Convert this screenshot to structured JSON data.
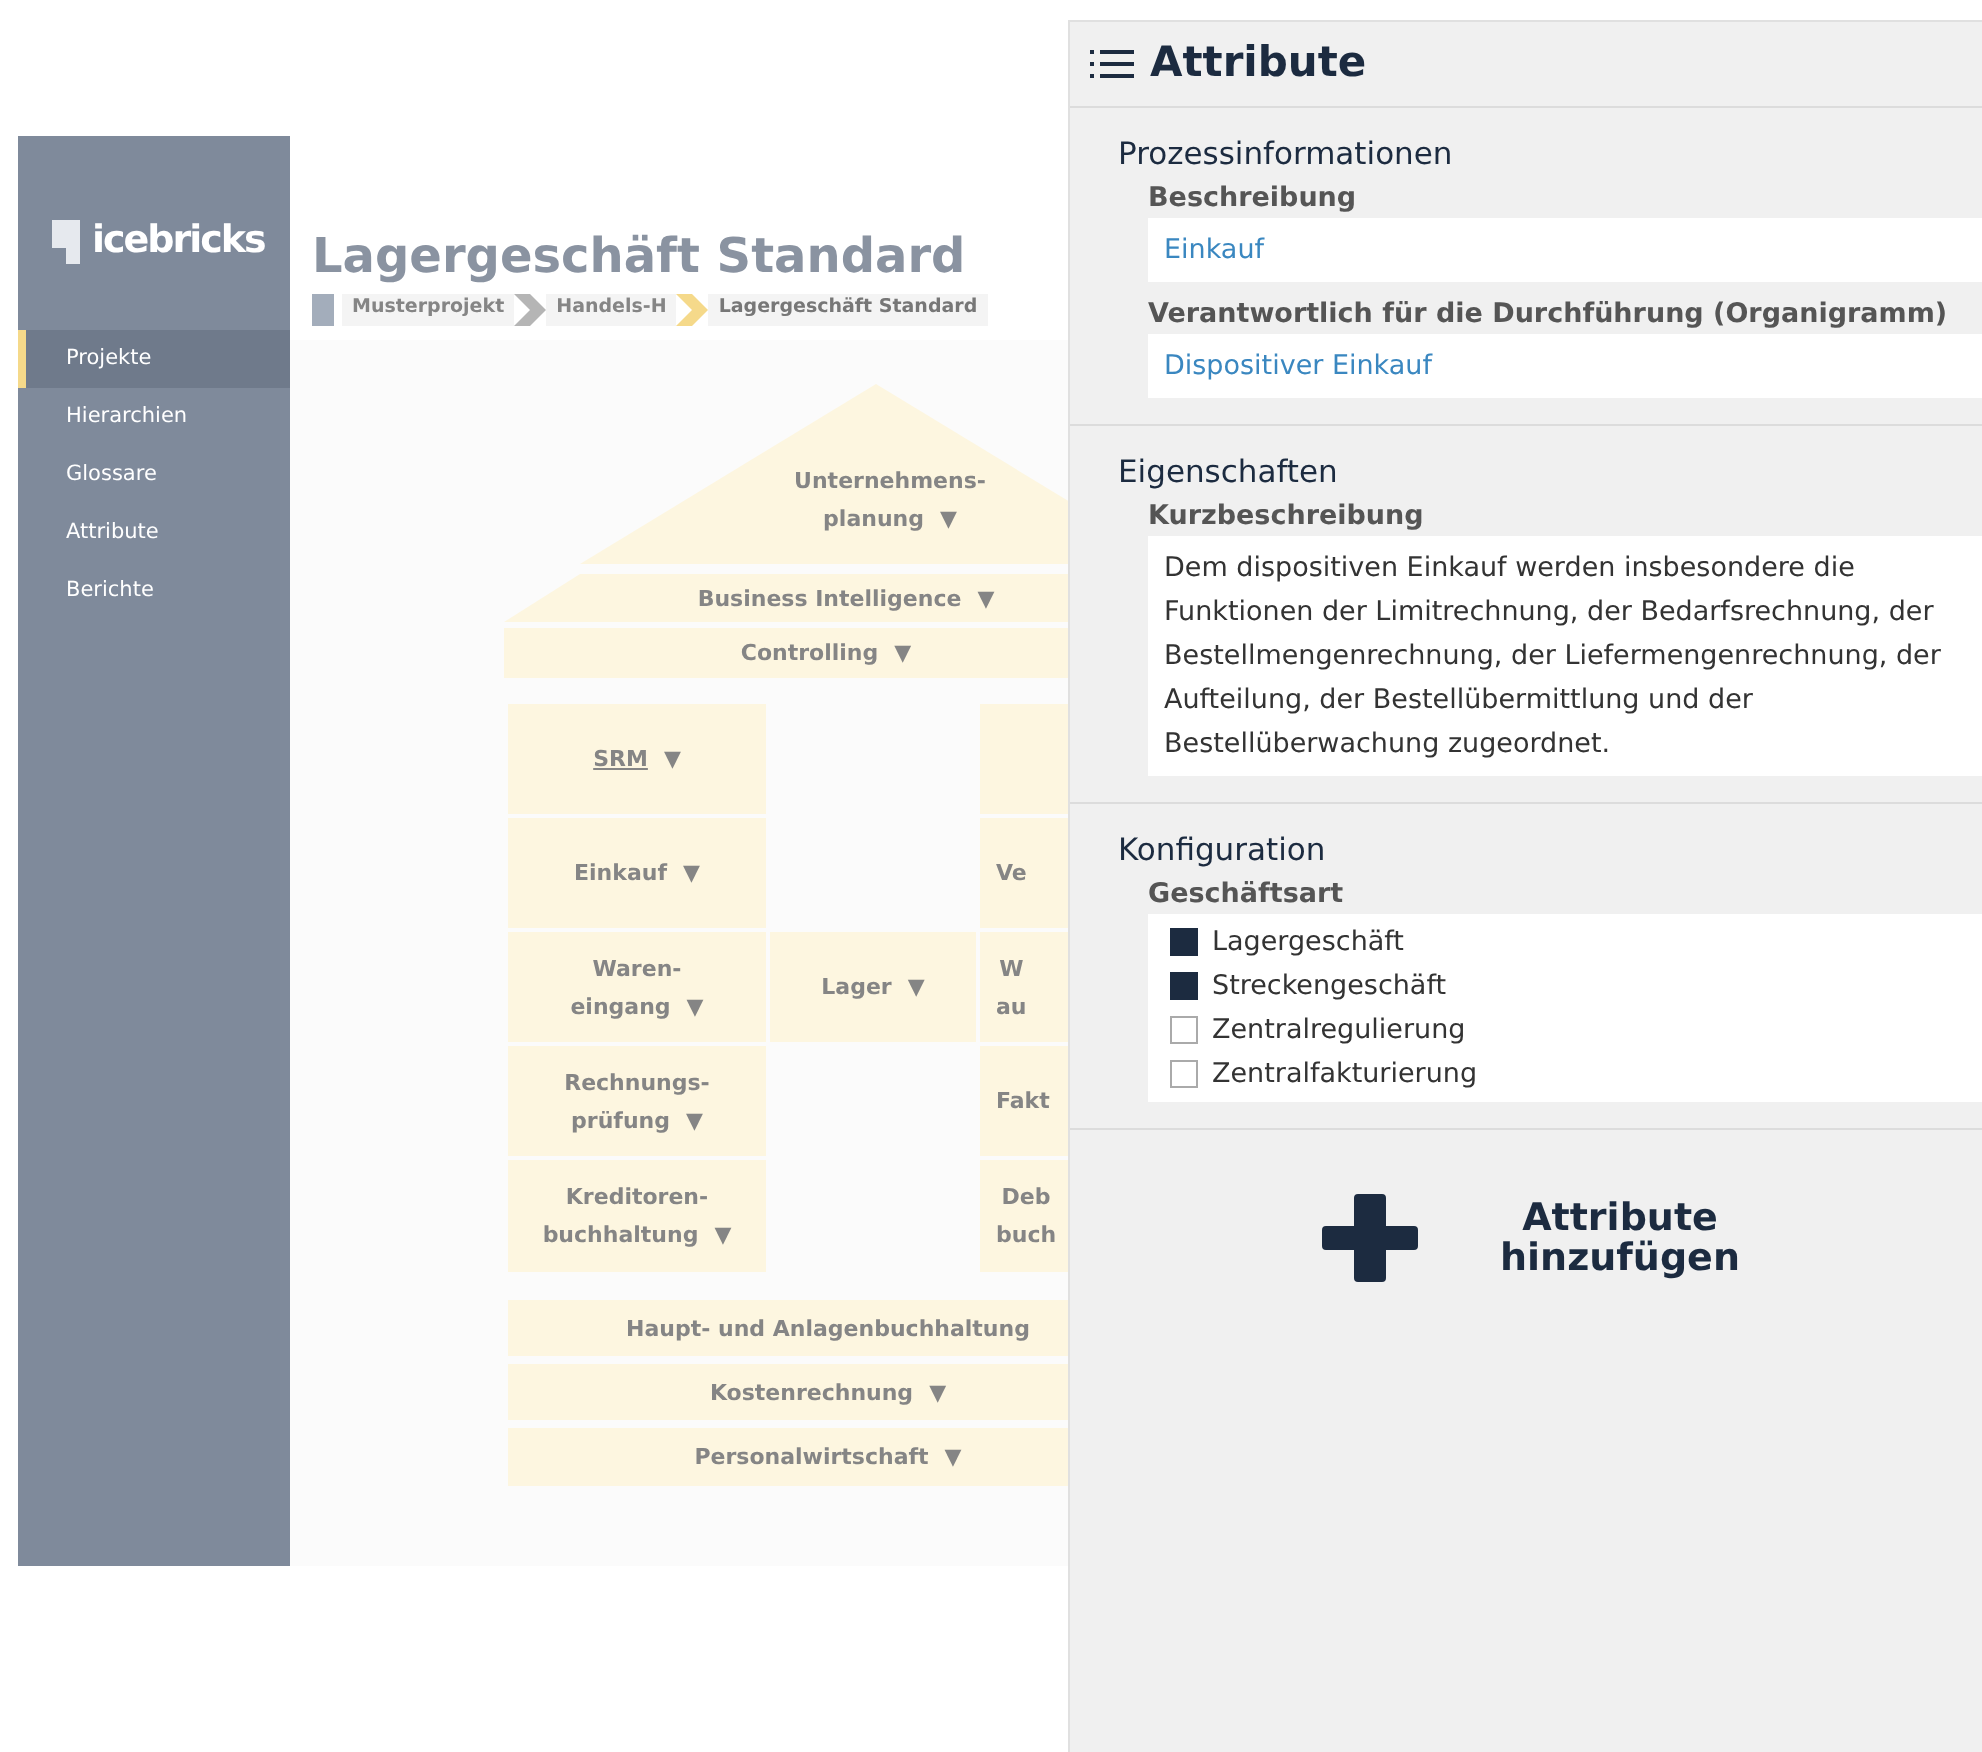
{
  "app": {
    "logo": "icebricks",
    "nav": [
      {
        "label": "Projekte",
        "selected": true
      },
      {
        "label": "Hierarchien",
        "selected": false
      },
      {
        "label": "Glossare",
        "selected": false
      },
      {
        "label": "Attribute",
        "selected": false
      },
      {
        "label": "Berichte",
        "selected": false
      }
    ],
    "title": "Lagergeschäft Standard",
    "breadcrumb": [
      {
        "label": "Musterprojekt",
        "selected": false
      },
      {
        "label": "Handels-H",
        "selected": false
      },
      {
        "label": "Lagergeschäft Standard",
        "selected": true
      }
    ],
    "diagram": [
      {
        "kind": "roof",
        "lines": [
          "Unternehmens-",
          "planung"
        ],
        "arrow": "▼"
      },
      {
        "kind": "trapezoid",
        "lines": [
          "Business Intelligence"
        ],
        "arrow": "▼"
      },
      {
        "kind": "band",
        "lines": [
          "Controlling"
        ],
        "arrow": "▼"
      },
      {
        "kind": "block",
        "lines": [
          "SRM"
        ],
        "arrow": "▼",
        "underlined": true
      },
      {
        "kind": "block",
        "lines": [
          "Einkauf"
        ],
        "arrow": "▼"
      },
      {
        "kind": "block",
        "lines": [
          "Waren-",
          "eingang"
        ],
        "arrow": "▼"
      },
      {
        "kind": "block",
        "lines": [
          "Lager"
        ],
        "arrow": "▼"
      },
      {
        "kind": "block",
        "lines": [
          "Rechnungs-",
          "prüfung"
        ],
        "arrow": "▼"
      },
      {
        "kind": "block",
        "lines": [
          "Kreditoren-",
          "buchhaltung"
        ],
        "arrow": "▼"
      },
      {
        "kind": "block"
      },
      {
        "kind": "block",
        "lines": [
          "Ve"
        ]
      },
      {
        "kind": "block",
        "lines": [
          "W",
          "au"
        ]
      },
      {
        "kind": "block",
        "lines": [
          "Fakt"
        ]
      },
      {
        "kind": "block",
        "lines": [
          "Deb",
          "buch"
        ]
      },
      {
        "kind": "band",
        "lines": [
          "Haupt- und Anlagenbuchhaltung"
        ]
      },
      {
        "kind": "band",
        "lines": [
          "Kostenrechnung"
        ],
        "arrow": "▼"
      },
      {
        "kind": "band",
        "lines": [
          "Personalwirtschaft"
        ],
        "arrow": "▼"
      }
    ]
  },
  "panel": {
    "title": "Attribute",
    "sections": [
      {
        "title": "Prozessinformationen",
        "fields": [
          {
            "kind": "link",
            "label": "Beschreibung",
            "value": "Einkauf"
          },
          {
            "kind": "link",
            "label": "Verantwortlich für die Durchführung (Organigramm)",
            "value": "Dispositiver Einkauf"
          }
        ]
      },
      {
        "title": "Eigenschaften",
        "fields": [
          {
            "kind": "text",
            "label": "Kurzbeschreibung",
            "value": "Dem dispositiven Einkauf werden insbesondere die Funktionen der Limitrechnung, der Bedarfsrechnung, der Bestellmengenrechnung, der Liefermengenrechnung, der Aufteilung, der Bestellübermittlung und der Bestellüberwachung zugeordnet."
          }
        ]
      },
      {
        "title": "Konfiguration",
        "fields": [
          {
            "kind": "checklist",
            "label": "Geschäftsart",
            "options": [
              {
                "label": "Lagergeschäft",
                "checked": true
              },
              {
                "label": "Streckengeschäft",
                "checked": true
              },
              {
                "label": "Zentralregulierung",
                "checked": false
              },
              {
                "label": "Zentralfakturierung",
                "checked": false
              }
            ]
          }
        ]
      }
    ],
    "add_button": "Attribute hinzufügen"
  }
}
